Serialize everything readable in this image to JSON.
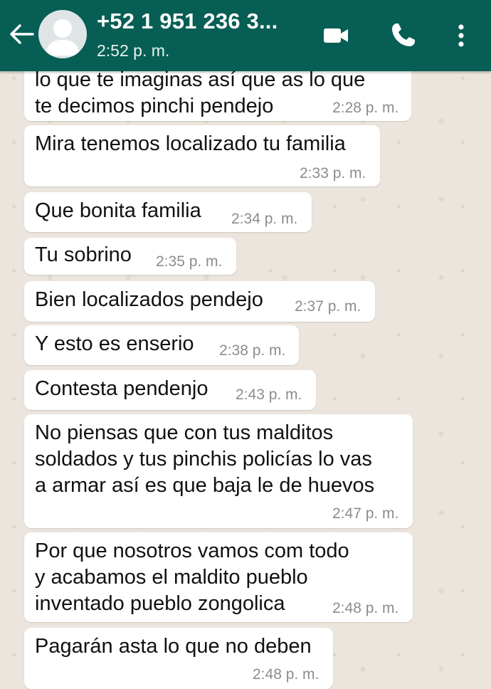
{
  "header": {
    "contact_name": "+52 1 951 236 3...",
    "last_seen": "2:52 p. m.",
    "colors": {
      "bar": "#075e54",
      "text": "#ffffff"
    },
    "icons": [
      "back-arrow-icon",
      "avatar-icon",
      "video-call-icon",
      "phone-call-icon",
      "more-vert-icon"
    ]
  },
  "messages": [
    {
      "text": "lo que te imaginas así que as lo que\nte decimos pinchi pendejo",
      "time": "2:28 p. m."
    },
    {
      "text": "Mira tenemos localizado tu familia",
      "time": "2:33 p. m."
    },
    {
      "text": "Que bonita familia",
      "time": "2:34 p. m."
    },
    {
      "text": "Tu sobrino",
      "time": "2:35 p. m."
    },
    {
      "text": "Bien localizados pendejo",
      "time": "2:37 p. m."
    },
    {
      "text": "Y esto es enserio",
      "time": "2:38 p. m."
    },
    {
      "text": "Contesta pendenjo",
      "time": "2:43 p. m."
    },
    {
      "text": "No piensas que con tus malditos\nsoldados y tus pinchis policías lo vas\na armar así es que baja le de huevos",
      "time": "2:47 p. m."
    },
    {
      "text": "Por que nosotros vamos com todo\ny acabamos el maldito pueblo\ninventado pueblo zongolica",
      "time": "2:48 p. m."
    },
    {
      "text": "Pagarán asta lo que no deben",
      "time": "2:48 p. m."
    }
  ],
  "theme": {
    "chat_background": "#ece5dd",
    "bubble": "#ffffff",
    "time_color": "#8c8c8c"
  }
}
